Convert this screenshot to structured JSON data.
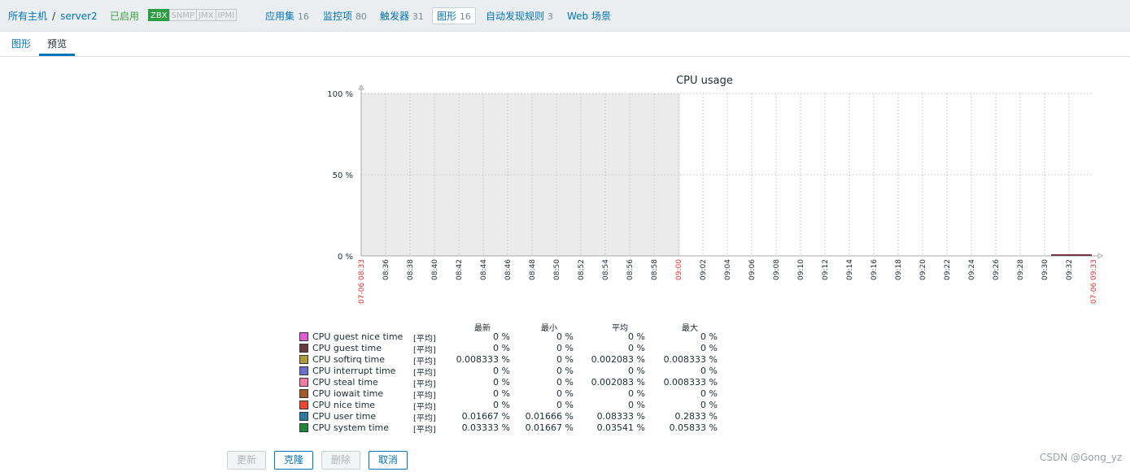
{
  "breadcrumb": {
    "all_hosts": "所有主机",
    "separator": "/",
    "host": "server2",
    "status": "已启用"
  },
  "availability": [
    "ZBX",
    "SNMP",
    "JMX",
    "IPMI"
  ],
  "host_nav": [
    {
      "label": "应用集",
      "count": "16"
    },
    {
      "label": "监控项",
      "count": "80"
    },
    {
      "label": "触发器",
      "count": "31"
    },
    {
      "label": "图形",
      "count": "16"
    },
    {
      "label": "自动发现规则",
      "count": "3"
    },
    {
      "label": "Web 场景",
      "count": ""
    }
  ],
  "tabs": [
    "图形",
    "预览"
  ],
  "chart": {
    "title": "CPU usage",
    "y_ticks": [
      "100 %",
      "50 %",
      "0 %"
    ],
    "x_start_label": "07-06 08:33",
    "x_end_label": "07-06 09:33",
    "x_ticks": [
      "08:36",
      "08:38",
      "08:40",
      "08:42",
      "08:44",
      "08:46",
      "08:48",
      "08:50",
      "08:52",
      "08:54",
      "08:56",
      "08:58",
      "09:00",
      "09:02",
      "09:04",
      "09:06",
      "09:08",
      "09:10",
      "09:12",
      "09:14",
      "09:16",
      "09:18",
      "09:20",
      "09:22",
      "09:24",
      "09:26",
      "09:28",
      "09:30",
      "09:32"
    ],
    "highlight_tick": "09:00"
  },
  "chart_data": {
    "type": "area",
    "title": "CPU usage",
    "x_range": [
      "07-06 08:33",
      "07-06 09:33"
    ],
    "ylim": [
      0,
      100
    ],
    "y_unit": "%",
    "grid": true,
    "no_data_until": "09:00",
    "legend_columns": [
      "最新",
      "最小",
      "平均",
      "最大"
    ],
    "series": [
      {
        "name": "CPU guest nice time",
        "color": "#e45bd7",
        "func": "[平均]",
        "last": "0 %",
        "min": "0 %",
        "avg": "0 %",
        "max": "0 %"
      },
      {
        "name": "CPU guest time",
        "color": "#6b3a3f",
        "func": "[平均]",
        "last": "0 %",
        "min": "0 %",
        "avg": "0 %",
        "max": "0 %"
      },
      {
        "name": "CPU softirq time",
        "color": "#b09a3a",
        "func": "[平均]",
        "last": "0.008333 %",
        "min": "0 %",
        "avg": "0.002083 %",
        "max": "0.008333 %"
      },
      {
        "name": "CPU interrupt time",
        "color": "#6a6ecf",
        "func": "[平均]",
        "last": "0 %",
        "min": "0 %",
        "avg": "0 %",
        "max": "0 %"
      },
      {
        "name": "CPU steal time",
        "color": "#f27ca2",
        "func": "[平均]",
        "last": "0 %",
        "min": "0 %",
        "avg": "0.002083 %",
        "max": "0.008333 %"
      },
      {
        "name": "CPU iowait time",
        "color": "#a65a28",
        "func": "[平均]",
        "last": "0 %",
        "min": "0 %",
        "avg": "0 %",
        "max": "0 %"
      },
      {
        "name": "CPU nice time",
        "color": "#f2472e",
        "func": "[平均]",
        "last": "0 %",
        "min": "0 %",
        "avg": "0 %",
        "max": "0 %"
      },
      {
        "name": "CPU user time",
        "color": "#2a7aa0",
        "func": "[平均]",
        "last": "0.01667 %",
        "min": "0.01666 %",
        "avg": "0.08333 %",
        "max": "0.2833 %"
      },
      {
        "name": "CPU system time",
        "color": "#21883a",
        "func": "[平均]",
        "last": "0.03333 %",
        "min": "0.01667 %",
        "avg": "0.03541 %",
        "max": "0.05833 %"
      }
    ]
  },
  "buttons": {
    "update": "更新",
    "clone": "克隆",
    "delete": "删除",
    "cancel": "取消"
  },
  "watermark": "CSDN @Gong_yz"
}
